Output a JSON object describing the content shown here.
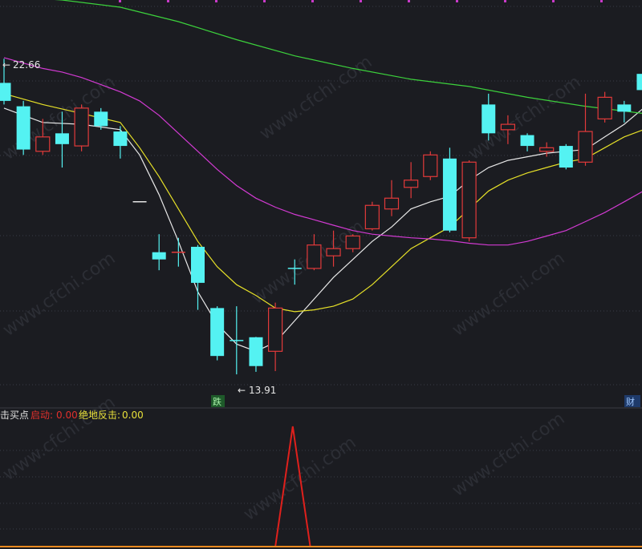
{
  "main_panel": {
    "high_marker": "22.66",
    "low_marker": "13.91",
    "badge_left": "跌",
    "badge_right": "财"
  },
  "indicator_panel": {
    "name": "击买点",
    "fields": [
      {
        "label": "启动:",
        "value": "0.00",
        "color": "#e0302c"
      },
      {
        "label": "绝地反击:",
        "value": "0.00",
        "color": "#e8e03a"
      }
    ]
  },
  "watermark": "www.cfchi.com",
  "colors": {
    "background": "#1b1c21",
    "up_candle": "#e23a3a",
    "down_candle": "#54f2f2",
    "ma_white": "#e8e8e8",
    "ma_yellow": "#e6e028",
    "ma_magenta": "#d23ad2",
    "ma_green": "#3cd23c",
    "signal_line": "#e0201c",
    "baseline": "#e88a20"
  },
  "chart_data": [
    {
      "type": "candlestick",
      "ylim": [
        13.0,
        24.3
      ],
      "grid": true,
      "candles": [
        {
          "open": 22.0,
          "close": 21.5,
          "high": 22.67,
          "low": 21.4
        },
        {
          "open": 21.35,
          "close": 20.15,
          "high": 21.5,
          "low": 20.0
        },
        {
          "open": 20.1,
          "close": 20.5,
          "high": 21.0,
          "low": 20.0
        },
        {
          "open": 20.6,
          "close": 20.3,
          "high": 21.2,
          "low": 19.65
        },
        {
          "open": 20.25,
          "close": 21.3,
          "high": 21.4,
          "low": 20.1
        },
        {
          "open": 21.2,
          "close": 20.8,
          "high": 21.3,
          "low": 20.7
        },
        {
          "open": 20.65,
          "close": 20.25,
          "high": 20.8,
          "low": 19.9
        },
        {
          "open": 18.7,
          "close": 18.7,
          "high": 18.7,
          "low": 18.7
        },
        {
          "open": 17.3,
          "close": 17.1,
          "high": 17.8,
          "low": 16.8
        },
        {
          "open": 17.3,
          "close": 17.3,
          "high": 17.7,
          "low": 16.9
        },
        {
          "open": 17.45,
          "close": 16.45,
          "high": 17.5,
          "low": 15.7
        },
        {
          "open": 15.75,
          "close": 14.42,
          "high": 15.8,
          "low": 14.3
        },
        {
          "open": 14.85,
          "close": 14.85,
          "high": 15.8,
          "low": 13.91
        },
        {
          "open": 14.94,
          "close": 14.14,
          "high": 14.95,
          "low": 13.98
        },
        {
          "open": 14.55,
          "close": 15.75,
          "high": 15.9,
          "low": 14.0
        },
        {
          "open": 16.85,
          "close": 16.85,
          "high": 17.1,
          "low": 16.4
        },
        {
          "open": 16.85,
          "close": 17.5,
          "high": 17.8,
          "low": 16.8
        },
        {
          "open": 17.2,
          "close": 17.4,
          "high": 17.9,
          "low": 16.9
        },
        {
          "open": 17.4,
          "close": 17.75,
          "high": 17.8,
          "low": 17.3
        },
        {
          "open": 17.95,
          "close": 18.6,
          "high": 18.7,
          "low": 17.9
        },
        {
          "open": 18.5,
          "close": 18.8,
          "high": 19.3,
          "low": 18.3
        },
        {
          "open": 19.1,
          "close": 19.3,
          "high": 19.8,
          "low": 18.8
        },
        {
          "open": 19.4,
          "close": 20.0,
          "high": 20.1,
          "low": 19.3
        },
        {
          "open": 19.9,
          "close": 17.9,
          "high": 20.2,
          "low": 17.85
        },
        {
          "open": 17.7,
          "close": 19.8,
          "high": 19.85,
          "low": 17.6
        },
        {
          "open": 21.4,
          "close": 20.6,
          "high": 21.7,
          "low": 20.4
        },
        {
          "open": 20.7,
          "close": 20.85,
          "high": 21.1,
          "low": 20.3
        },
        {
          "open": 20.55,
          "close": 20.25,
          "high": 20.6,
          "low": 20.1
        },
        {
          "open": 20.1,
          "close": 20.2,
          "high": 20.35,
          "low": 19.95
        },
        {
          "open": 20.25,
          "close": 19.65,
          "high": 20.3,
          "low": 19.6
        },
        {
          "open": 19.8,
          "close": 20.65,
          "high": 21.7,
          "low": 19.7
        },
        {
          "open": 21.0,
          "close": 21.6,
          "high": 21.75,
          "low": 20.9
        },
        {
          "open": 21.4,
          "close": 21.2,
          "high": 21.5,
          "low": 20.9
        },
        {
          "open": 22.25,
          "close": 21.8,
          "high": 22.3,
          "low": 21.6
        }
      ],
      "moving_averages": [
        {
          "color": "#e8e8e8",
          "values": [
            [
              0,
              21.3
            ],
            [
              2,
              20.9
            ],
            [
              4,
              20.85
            ],
            [
              6,
              20.7
            ],
            [
              7,
              20.0
            ],
            [
              8,
              18.9
            ],
            [
              9,
              17.6
            ],
            [
              10,
              16.2
            ],
            [
              11,
              15.3
            ],
            [
              12,
              14.75
            ],
            [
              13,
              14.55
            ],
            [
              14,
              14.8
            ],
            [
              15,
              15.4
            ],
            [
              16,
              16.0
            ],
            [
              17,
              16.6
            ],
            [
              18,
              17.1
            ],
            [
              19,
              17.6
            ],
            [
              20,
              18.0
            ],
            [
              21,
              18.5
            ],
            [
              22,
              18.7
            ],
            [
              23,
              18.85
            ],
            [
              24,
              19.3
            ],
            [
              25,
              19.65
            ],
            [
              26,
              19.85
            ],
            [
              27,
              19.95
            ],
            [
              28,
              20.05
            ],
            [
              29,
              20.1
            ],
            [
              30,
              20.15
            ],
            [
              31,
              20.5
            ],
            [
              32,
              20.85
            ],
            [
              33,
              21.3
            ]
          ]
        },
        {
          "color": "#e6e028",
          "values": [
            [
              0,
              21.7
            ],
            [
              2,
              21.4
            ],
            [
              4,
              21.15
            ],
            [
              6,
              20.9
            ],
            [
              7,
              20.2
            ],
            [
              8,
              19.4
            ],
            [
              9,
              18.5
            ],
            [
              10,
              17.6
            ],
            [
              11,
              16.9
            ],
            [
              12,
              16.4
            ],
            [
              13,
              16.1
            ],
            [
              14,
              15.75
            ],
            [
              15,
              15.65
            ],
            [
              16,
              15.7
            ],
            [
              17,
              15.8
            ],
            [
              18,
              16.0
            ],
            [
              19,
              16.4
            ],
            [
              20,
              16.9
            ],
            [
              21,
              17.4
            ],
            [
              22,
              17.7
            ],
            [
              23,
              18.0
            ],
            [
              24,
              18.5
            ],
            [
              25,
              19.0
            ],
            [
              26,
              19.3
            ],
            [
              27,
              19.5
            ],
            [
              28,
              19.65
            ],
            [
              29,
              19.8
            ],
            [
              30,
              19.9
            ],
            [
              31,
              20.2
            ],
            [
              32,
              20.5
            ],
            [
              33,
              20.7
            ]
          ]
        },
        {
          "color": "#d23ad2",
          "values": [
            [
              0,
              22.7
            ],
            [
              1,
              22.55
            ],
            [
              2,
              22.4
            ],
            [
              3,
              22.3
            ],
            [
              4,
              22.15
            ],
            [
              5,
              21.95
            ],
            [
              6,
              21.75
            ],
            [
              7,
              21.5
            ],
            [
              8,
              21.1
            ],
            [
              9,
              20.6
            ],
            [
              10,
              20.1
            ],
            [
              11,
              19.6
            ],
            [
              12,
              19.15
            ],
            [
              13,
              18.8
            ],
            [
              14,
              18.55
            ],
            [
              15,
              18.35
            ],
            [
              16,
              18.2
            ],
            [
              17,
              18.05
            ],
            [
              18,
              17.9
            ],
            [
              19,
              17.8
            ],
            [
              20,
              17.75
            ],
            [
              21,
              17.7
            ],
            [
              22,
              17.67
            ],
            [
              23,
              17.62
            ],
            [
              24,
              17.55
            ],
            [
              25,
              17.5
            ],
            [
              26,
              17.5
            ],
            [
              27,
              17.6
            ],
            [
              28,
              17.75
            ],
            [
              29,
              17.9
            ],
            [
              30,
              18.15
            ],
            [
              31,
              18.4
            ],
            [
              32,
              18.7
            ],
            [
              33,
              19.0
            ]
          ]
        },
        {
          "color": "#3cd23c",
          "values": [
            [
              0,
              24.4
            ],
            [
              3,
              24.3
            ],
            [
              6,
              24.1
            ],
            [
              9,
              23.7
            ],
            [
              12,
              23.2
            ],
            [
              15,
              22.75
            ],
            [
              18,
              22.4
            ],
            [
              21,
              22.1
            ],
            [
              24,
              21.9
            ],
            [
              27,
              21.6
            ],
            [
              30,
              21.35
            ],
            [
              33,
              21.15
            ]
          ]
        }
      ]
    },
    {
      "type": "line",
      "ylim": [
        0,
        1
      ],
      "series": [
        {
          "name": "启动",
          "values": [
            [
              0,
              0
            ],
            [
              14,
              0
            ],
            [
              14.9,
              1
            ],
            [
              15.8,
              0
            ],
            [
              33,
              0
            ]
          ]
        }
      ]
    }
  ]
}
